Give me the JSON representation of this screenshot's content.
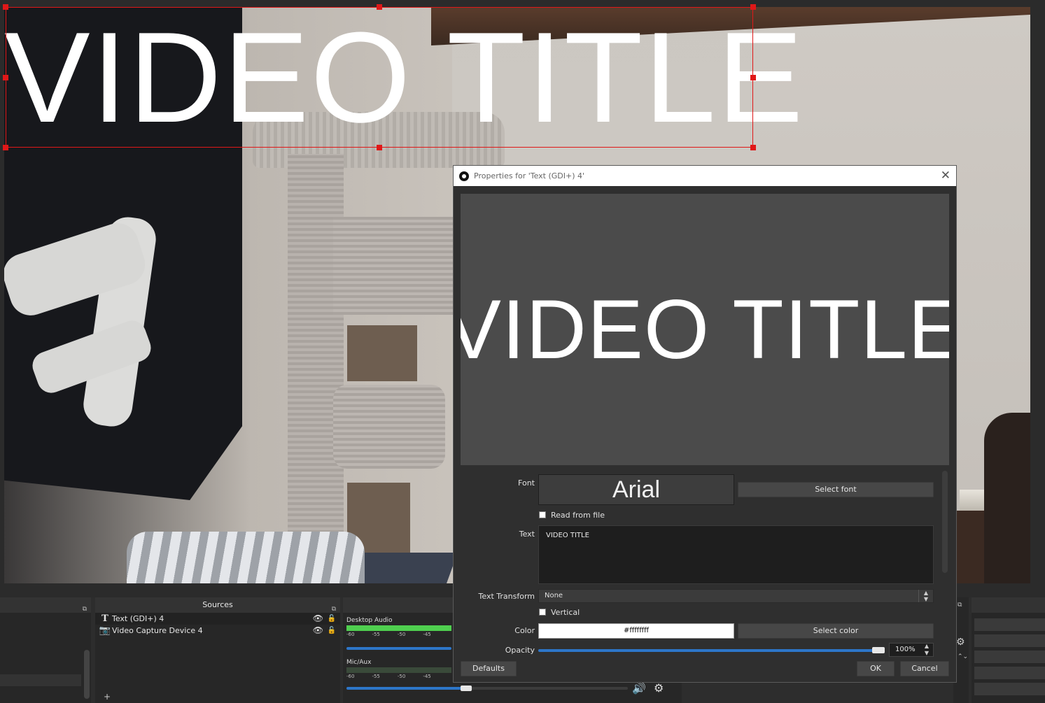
{
  "scene": {
    "title_text": "VIDEO TITLE"
  },
  "docks": {
    "sources_title": "Sources",
    "sources": [
      {
        "name": "Text (GDI+) 4",
        "icon": "text-icon"
      },
      {
        "name": "Video Capture Device 4",
        "icon": "camera-icon"
      }
    ],
    "mixer": [
      {
        "name": "Desktop Audio",
        "scale": [
          "-60",
          "-55",
          "-50",
          "-45"
        ],
        "level": 0.52
      },
      {
        "name": "Mic/Aux",
        "scale": [
          "-60",
          "-55",
          "-50",
          "-45"
        ],
        "level": 0.52
      }
    ]
  },
  "dialog": {
    "title": "Properties for 'Text (GDI+) 4'",
    "preview_text": "VIDEO TITLE",
    "font_label": "Font",
    "font_name": "Arial",
    "select_font_label": "Select font",
    "read_from_file_label": "Read from file",
    "text_label": "Text",
    "text_value": "VIDEO TITLE",
    "text_transform_label": "Text Transform",
    "text_transform_value": "None",
    "vertical_label": "Vertical",
    "color_label": "Color",
    "color_value": "#ffffffff",
    "select_color_label": "Select color",
    "opacity_label": "Opacity",
    "opacity_value": "100%",
    "opacity_level": 1.0,
    "defaults_label": "Defaults",
    "ok_label": "OK",
    "cancel_label": "Cancel"
  },
  "colors": {
    "selection": "#e01818",
    "accent_blue": "#2d76c9",
    "meter_green": "#4fcf4f"
  }
}
